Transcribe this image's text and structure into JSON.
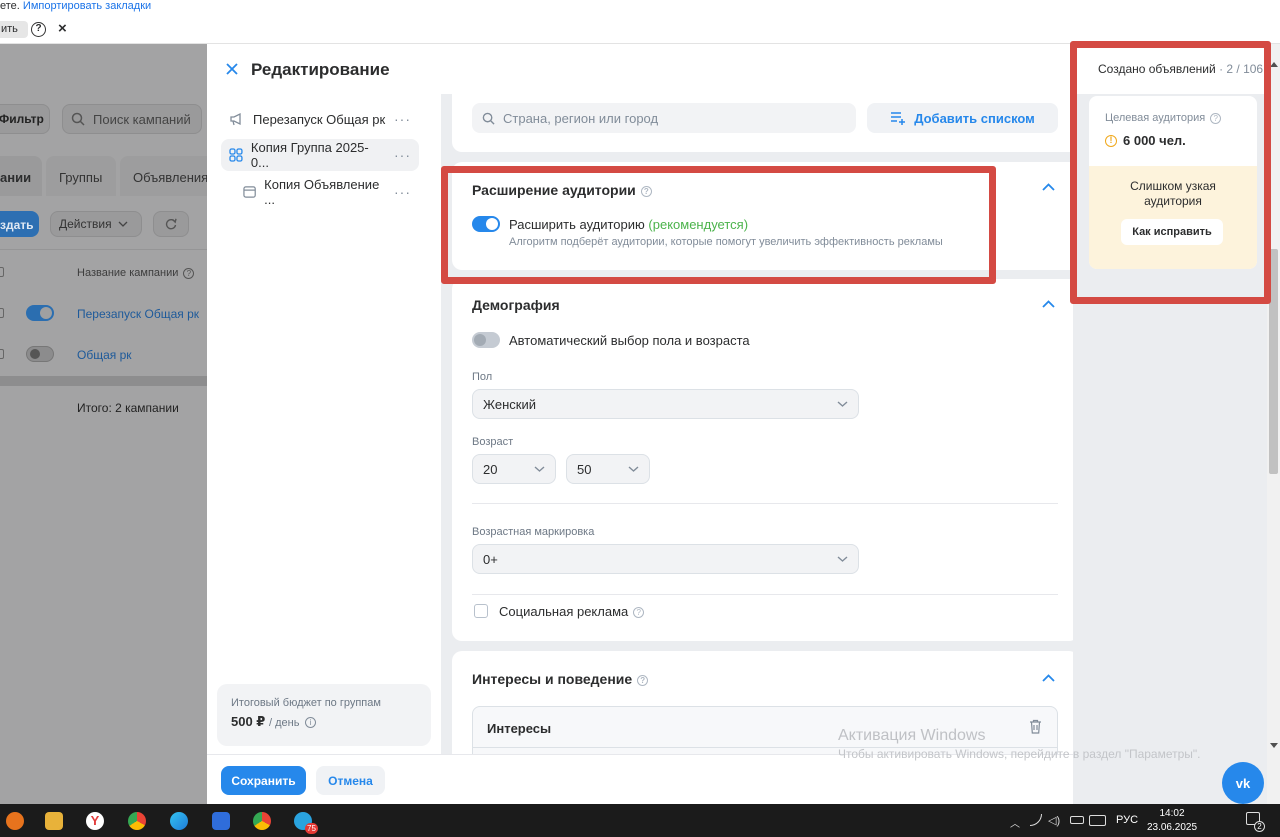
{
  "browser": {
    "bookmarks_prefix": "ете.",
    "bookmarks_link": "Импортировать закладки",
    "tab_fragment": "ить",
    "help_glyph": "?",
    "close_glyph": "×"
  },
  "background": {
    "filter": "Фильтр",
    "search_placeholder": "Поиск кампаний",
    "tabs": [
      "ании",
      "Группы",
      "Объявления"
    ],
    "create": "здать",
    "actions": "Действия",
    "col_header": "Название кампании",
    "rows": [
      "Перезапуск Общая рк",
      "Общая рк"
    ],
    "total": "Итого: 2 кампании"
  },
  "modal": {
    "title": "Редактирование",
    "nav": [
      {
        "label": "Перезапуск Общая рк",
        "icon": "megaphone-icon"
      },
      {
        "label": "Копия Группа 2025-0...",
        "icon": "grid-icon"
      },
      {
        "label": "Копия Объявление ...",
        "icon": "ad-icon"
      }
    ],
    "budget_label": "Итоговый бюджет по группам",
    "budget_value": "500 ₽",
    "budget_period": "/ день",
    "geo": {
      "placeholder": "Страна, регион или город",
      "add_list": "Добавить списком"
    },
    "expansion": {
      "title": "Расширение аудитории",
      "toggle_label": "Расширить аудиторию",
      "recommended": "(рекомендуется)",
      "hint": "Алгоритм подберёт аудитории, которые помогут увеличить эффективность рекламы"
    },
    "demography": {
      "title": "Демография",
      "auto_label": "Автоматический выбор пола и возраста",
      "sex_label": "Пол",
      "sex_value": "Женский",
      "age_label": "Возраст",
      "age_from": "20",
      "age_to": "50",
      "age_mark_label": "Возрастная маркировка",
      "age_mark_value": "0+",
      "social_label": "Социальная реклама"
    },
    "interests": {
      "title": "Интересы и поведение",
      "sub": "Интересы"
    },
    "save": "Сохранить",
    "cancel": "Отмена"
  },
  "right_panel": {
    "created_label": "Создано объявлений",
    "created_count": "· 2 / 106",
    "audience_label": "Целевая аудитория",
    "audience_value": "6 000 чел.",
    "warning": "Слишком узкая аудитория",
    "fix_button": "Как исправить"
  },
  "watermark": {
    "title": "Активация Windows",
    "text": "Чтобы активировать Windows, перейдите в раздел \"Параметры\"."
  },
  "taskbar": {
    "lang": "РУС",
    "time": "14:02",
    "date": "23.06.2025",
    "telegram_badge": "75",
    "notif_count": "2"
  },
  "colors": {
    "accent": "#2688eb",
    "highlight": "#d44a43",
    "warning_bg": "#fdf3dc",
    "success": "#4bb34b"
  }
}
